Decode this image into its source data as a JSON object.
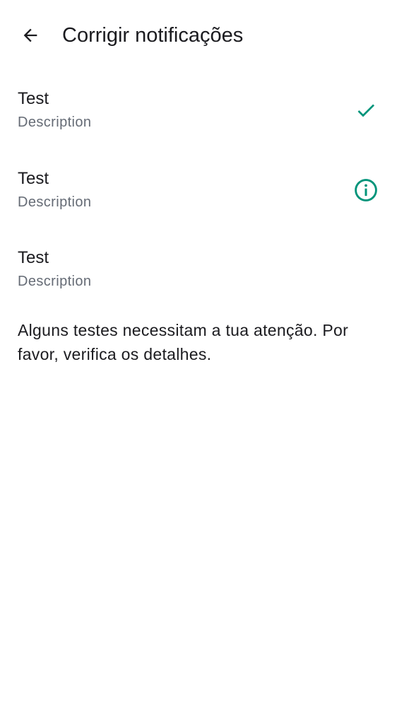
{
  "header": {
    "back_icon": "arrow-back-icon",
    "title": "Corrigir notificações"
  },
  "tests": [
    {
      "title": "Test",
      "description": "Description",
      "status_icon": "check-icon",
      "status": "passed"
    },
    {
      "title": "Test",
      "description": "Description",
      "status_icon": "info-icon",
      "status": "attention"
    },
    {
      "title": "Test",
      "description": "Description",
      "status_icon": "",
      "status": "none"
    }
  ],
  "message": "Alguns testes necessitam a tua atenção. Por favor, verifica os detalhes.",
  "colors": {
    "accent": "#00947a",
    "text_primary": "#1b1b1f",
    "text_secondary": "#656b75",
    "background": "#ffffff"
  }
}
